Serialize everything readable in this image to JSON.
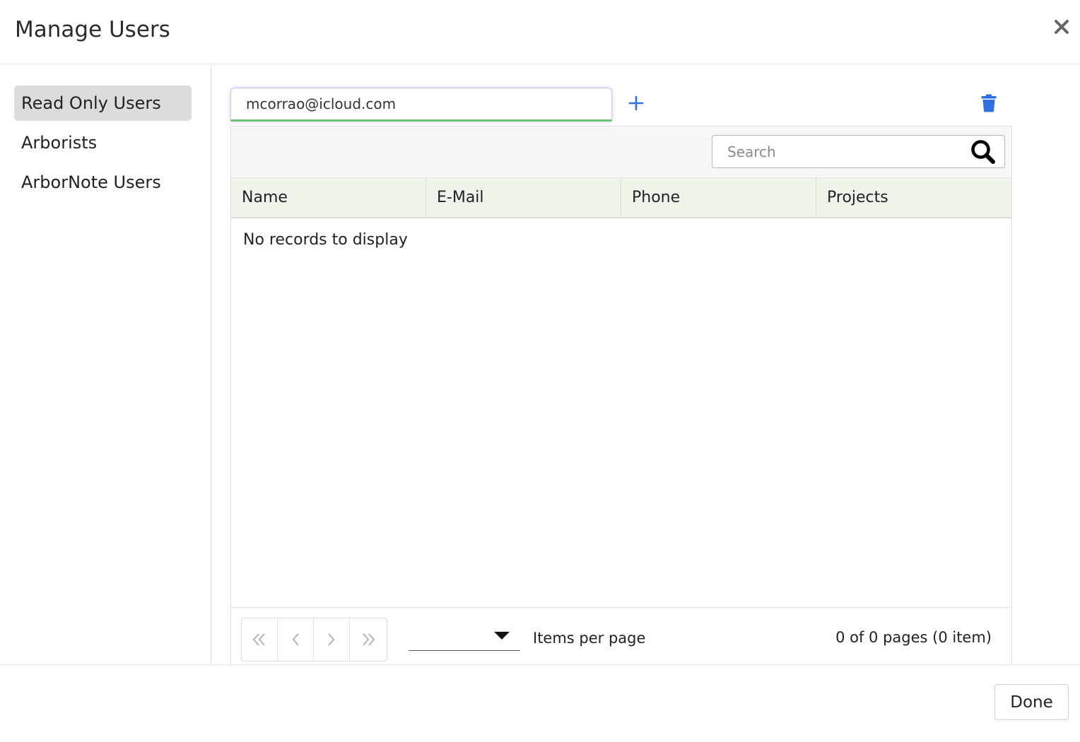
{
  "dialog": {
    "title": "Manage Users",
    "close_icon": "close-icon"
  },
  "sidebar": {
    "items": [
      {
        "label": "Read Only Users",
        "active": true
      },
      {
        "label": "Arborists",
        "active": false
      },
      {
        "label": "ArborNote Users",
        "active": false
      }
    ]
  },
  "email_field": {
    "value": "mcorrao@icloud.com"
  },
  "icons": {
    "add": "plus-icon",
    "delete": "trash-icon",
    "search": "search-icon"
  },
  "search": {
    "placeholder": "Search"
  },
  "table": {
    "columns": [
      "Name",
      "E-Mail",
      "Phone",
      "Projects"
    ],
    "empty_message": "No records to display"
  },
  "pager": {
    "page_size_value": "",
    "items_per_page_label": "Items per page",
    "info": "0 of 0 pages (0 item)"
  },
  "footer": {
    "done_label": "Done"
  },
  "colors": {
    "accent_blue": "#2f6fe0",
    "active_sidebar_bg": "#dcdcdc",
    "header_row_bg": "#eef4ea",
    "input_focus_underline": "#6cc070"
  }
}
